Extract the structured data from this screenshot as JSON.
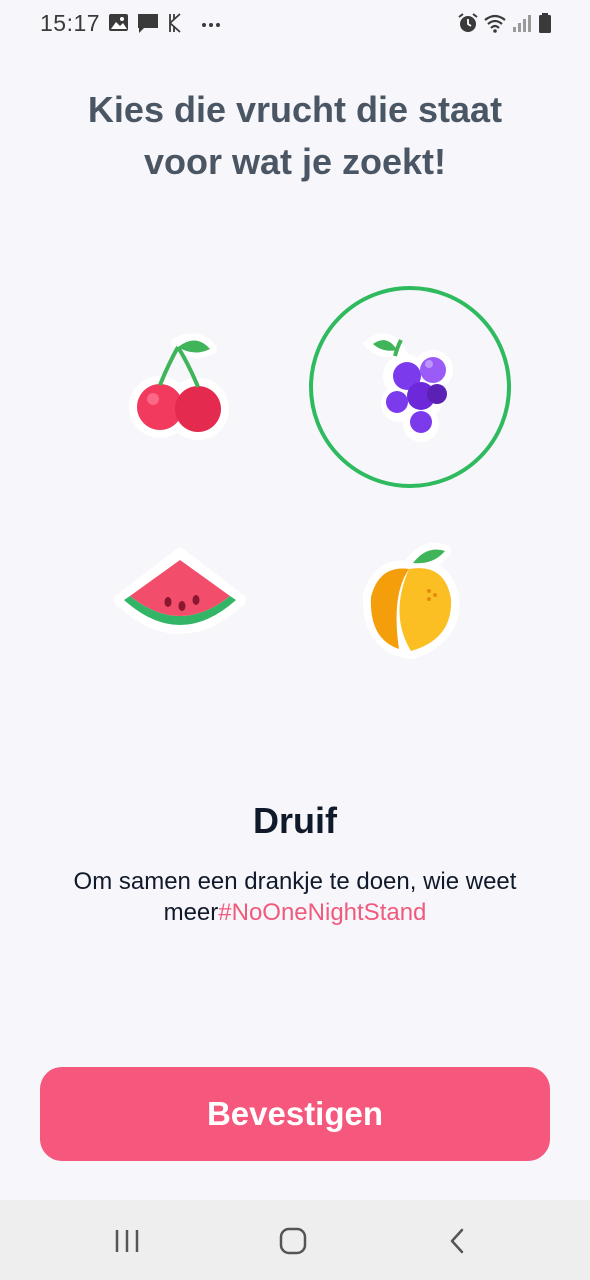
{
  "status_bar": {
    "time": "15:17",
    "left_icons": [
      "gallery-icon",
      "message-icon",
      "app-k-icon",
      "more-dots-icon"
    ],
    "right_icons": [
      "alarm-icon",
      "wifi-icon",
      "signal-icon",
      "battery-icon"
    ]
  },
  "title": {
    "line1": "Kies die vrucht die staat",
    "line2": "voor wat je zoekt!"
  },
  "fruits": [
    {
      "id": "cherry",
      "icon": "cherry-icon",
      "selected": false
    },
    {
      "id": "grape",
      "icon": "grape-icon",
      "selected": true
    },
    {
      "id": "watermelon",
      "icon": "watermelon-icon",
      "selected": false
    },
    {
      "id": "peach",
      "icon": "peach-icon",
      "selected": false
    }
  ],
  "selection": {
    "name": "Druif",
    "description": "Om samen een drankje te doen, wie weet meer",
    "hashtag": "#NoOneNightStand"
  },
  "confirm_button": {
    "label": "Bevestigen"
  },
  "colors": {
    "accent": "#f5577d",
    "selection_ring": "#2fba5f",
    "hashtag": "#ef5a7d",
    "title": "#4a5663"
  },
  "nav_bar": {
    "buttons": [
      "recent-apps-icon",
      "home-icon",
      "back-icon"
    ]
  }
}
